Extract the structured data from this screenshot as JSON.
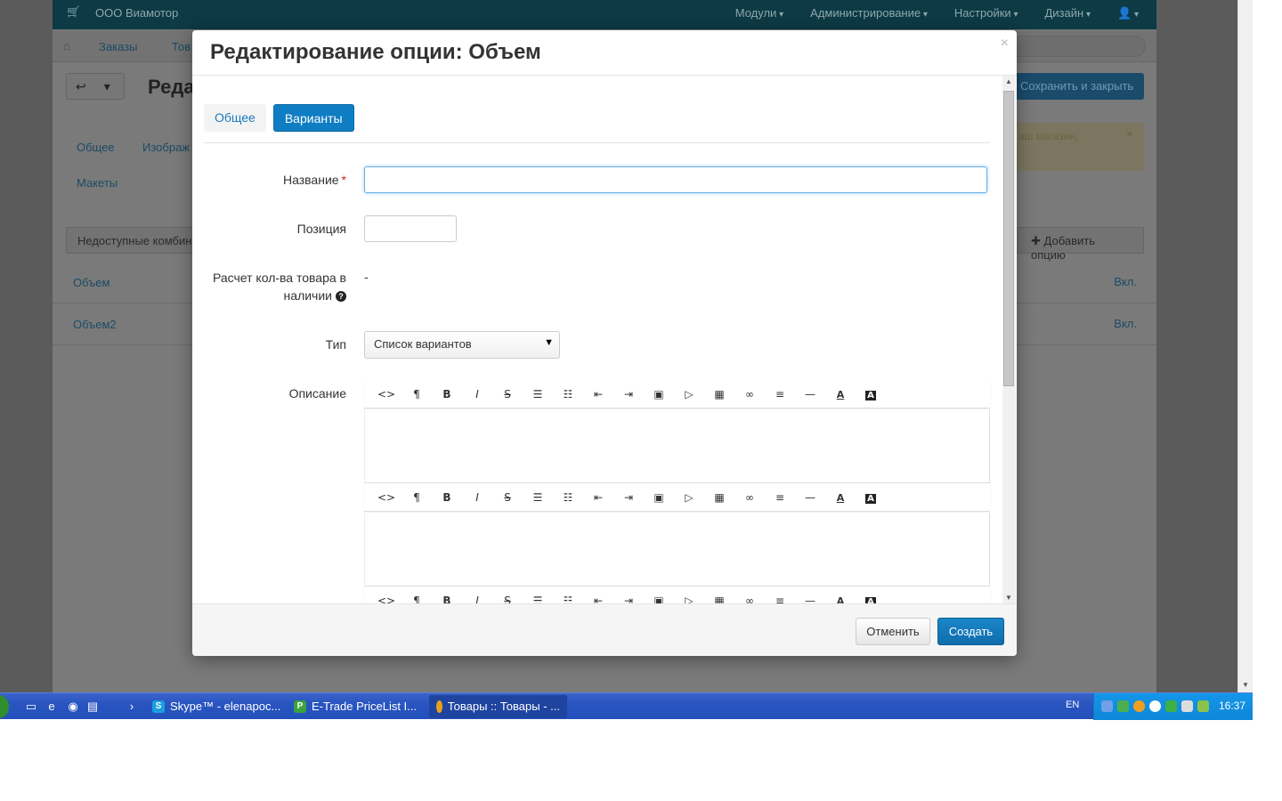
{
  "background_page": {
    "brand": "ООО Виамотор",
    "top_menu": [
      "Модули",
      "Администрирование",
      "Настройки",
      "Дизайн"
    ],
    "breadcrumb": {
      "orders": "Заказы",
      "goods": "Тов"
    },
    "title": "Реда",
    "save_close": "Сохранить и закрыть",
    "notice": "аш магазин,",
    "tabs": [
      "Общее",
      "Изображ",
      "Макеты"
    ],
    "unavailable": "Недоступные комбин",
    "add_option": "Добавить опцию",
    "options": [
      {
        "name": "Объем",
        "status": "Вкл."
      },
      {
        "name": "Объем2",
        "status": "Вкл."
      }
    ]
  },
  "modal": {
    "title": "Редактирование опции: Объем",
    "close": "×",
    "tabs": [
      {
        "label": "Общее",
        "active": false
      },
      {
        "label": "Варианты",
        "active": true
      }
    ],
    "fields": {
      "name_label": "Название",
      "required_mark": "*",
      "name_value": "",
      "position_label": "Позиция",
      "position_value": "",
      "calc_label_1": "Расчет кол-ва товара в",
      "calc_label_2": "наличии",
      "calc_value": "-",
      "type_label": "Тип",
      "type_value": "Список вариантов",
      "description_label": "Описание"
    },
    "toolbar_icons": [
      "code-icon",
      "paragraph-icon",
      "bold-icon",
      "italic-icon",
      "strikethrough-icon",
      "unordered-list-icon",
      "ordered-list-icon",
      "outdent-icon",
      "indent-icon",
      "image-icon",
      "video-icon",
      "table-icon",
      "link-icon",
      "align-icon",
      "horizontal-rule-icon",
      "font-color-icon",
      "background-color-icon"
    ],
    "footer": {
      "cancel": "Отменить",
      "create": "Создать"
    }
  },
  "taskbar": {
    "items": [
      {
        "label": "Skype™ - elenapoc...",
        "icon_color": "#1b9fe0"
      },
      {
        "label": "E-Trade PriceList I...",
        "icon_color": "#3aa33a"
      },
      {
        "label": "Товары :: Товары - ...",
        "icon_color": "#e6a21c"
      }
    ],
    "language": "EN",
    "time": "16:37"
  },
  "colors": {
    "primary": "#0f7dc2",
    "taskbar": "#2a55c0",
    "tray": "#0e87d8"
  }
}
